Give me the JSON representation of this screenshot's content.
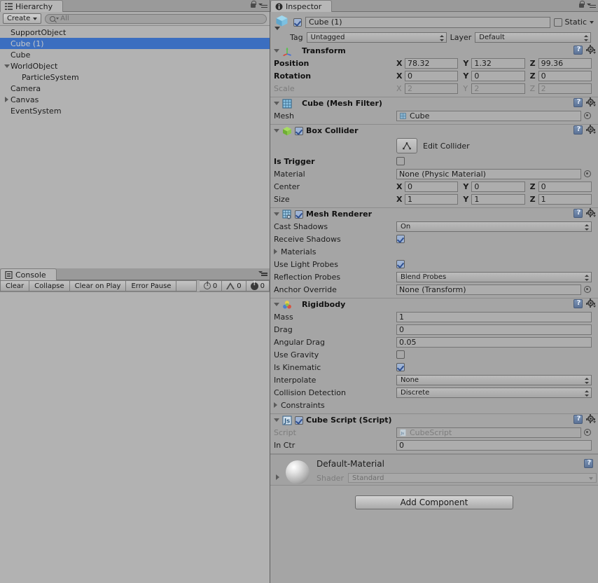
{
  "hierarchy": {
    "tab_label": "Hierarchy",
    "tab_icon": "hierarchy-icon",
    "create_label": "Create",
    "search_placeholder": "All",
    "search_value": "",
    "items": [
      {
        "label": "SupportObject",
        "indent": 0,
        "fold": "none",
        "selected": false
      },
      {
        "label": "Cube (1)",
        "indent": 0,
        "fold": "none",
        "selected": true
      },
      {
        "label": "Cube",
        "indent": 0,
        "fold": "none",
        "selected": false
      },
      {
        "label": "WorldObject",
        "indent": 0,
        "fold": "open",
        "selected": false
      },
      {
        "label": "ParticleSystem",
        "indent": 1,
        "fold": "none",
        "selected": false
      },
      {
        "label": "Camera",
        "indent": 0,
        "fold": "none",
        "selected": false
      },
      {
        "label": "Canvas",
        "indent": 0,
        "fold": "closed",
        "selected": false
      },
      {
        "label": "EventSystem",
        "indent": 0,
        "fold": "none",
        "selected": false
      }
    ]
  },
  "console": {
    "tab_label": "Console",
    "buttons": [
      "Clear",
      "Collapse",
      "Clear on Play",
      "Error Pause"
    ],
    "counts": {
      "info": "0",
      "warning": "0",
      "error": "0"
    }
  },
  "inspector": {
    "tab_label": "Inspector",
    "object": {
      "enabled": true,
      "name": "Cube (1)",
      "static_label": "Static",
      "static_checked": false,
      "tag_label": "Tag",
      "tag_value": "Untagged",
      "layer_label": "Layer",
      "layer_value": "Default"
    },
    "components": [
      {
        "title": "Transform",
        "icon": "transform-axis-icon",
        "has_enable_checkbox": false,
        "rows": [
          {
            "type": "vector3",
            "label": "Position",
            "bold": true,
            "x": "78.32",
            "y": "1.32",
            "z": "99.36"
          },
          {
            "type": "vector3",
            "label": "Rotation",
            "bold": true,
            "x": "0",
            "y": "0",
            "z": "0"
          },
          {
            "type": "vector3",
            "label": "Scale",
            "bold": false,
            "dim": true,
            "x": "2",
            "y": "2",
            "z": "2"
          }
        ]
      },
      {
        "title": "Cube (Mesh Filter)",
        "icon": "mesh-filter-icon",
        "has_enable_checkbox": false,
        "rows": [
          {
            "type": "object",
            "label": "Mesh",
            "value": "Cube",
            "value_icon": "mesh-icon"
          }
        ]
      },
      {
        "title": "Box Collider",
        "icon": "box-collider-icon",
        "has_enable_checkbox": true,
        "enabled": true,
        "rows": [
          {
            "type": "editcollider",
            "button_icon": "edit-collider-icon",
            "label": "Edit Collider"
          },
          {
            "type": "checkbox",
            "label": "Is Trigger",
            "bold": true,
            "checked": false
          },
          {
            "type": "object",
            "label": "Material",
            "value": "None (Physic Material)"
          },
          {
            "type": "vector3",
            "label": "Center",
            "x": "0",
            "y": "0",
            "z": "0"
          },
          {
            "type": "vector3",
            "label": "Size",
            "x": "1",
            "y": "1",
            "z": "1"
          }
        ]
      },
      {
        "title": "Mesh Renderer",
        "icon": "mesh-renderer-icon",
        "has_enable_checkbox": true,
        "enabled": true,
        "rows": [
          {
            "type": "dropdown",
            "label": "Cast Shadows",
            "value": "On"
          },
          {
            "type": "checkbox",
            "label": "Receive Shadows",
            "checked": true
          },
          {
            "type": "foldout",
            "label": "Materials",
            "open": false
          },
          {
            "type": "checkbox",
            "label": "Use Light Probes",
            "checked": true
          },
          {
            "type": "dropdown",
            "label": "Reflection Probes",
            "value": "Blend Probes"
          },
          {
            "type": "object",
            "label": "Anchor Override",
            "value": "None (Transform)"
          }
        ]
      },
      {
        "title": "Rigidbody",
        "icon": "rigidbody-icon",
        "has_enable_checkbox": false,
        "rows": [
          {
            "type": "text",
            "label": "Mass",
            "value": "1"
          },
          {
            "type": "text",
            "label": "Drag",
            "value": "0"
          },
          {
            "type": "text",
            "label": "Angular Drag",
            "value": "0.05"
          },
          {
            "type": "checkbox",
            "label": "Use Gravity",
            "checked": false
          },
          {
            "type": "checkbox",
            "label": "Is Kinematic",
            "checked": true
          },
          {
            "type": "dropdown",
            "label": "Interpolate",
            "value": "None"
          },
          {
            "type": "dropdown",
            "label": "Collision Detection",
            "value": "Discrete"
          },
          {
            "type": "foldout",
            "label": "Constraints",
            "open": false
          }
        ]
      },
      {
        "title": "Cube Script (Script)",
        "icon": "js-script-icon",
        "has_enable_checkbox": true,
        "enabled": true,
        "rows": [
          {
            "type": "object",
            "label": "Script",
            "value": "CubeScript",
            "dim": true,
            "value_icon": "js-file-icon"
          },
          {
            "type": "text",
            "label": "In Ctr",
            "value": "0"
          }
        ]
      }
    ],
    "material": {
      "name": "Default-Material",
      "shader_label": "Shader",
      "shader_value": "Standard",
      "preview_icon": "material-sphere-preview"
    },
    "add_component_label": "Add Component"
  },
  "colors": {
    "panel_bg": "#b2b2b2",
    "inspector_bg": "#a5a5a5",
    "selection_blue": "#3b6ec0",
    "field_bg": "#adadad",
    "border": "#757575"
  }
}
